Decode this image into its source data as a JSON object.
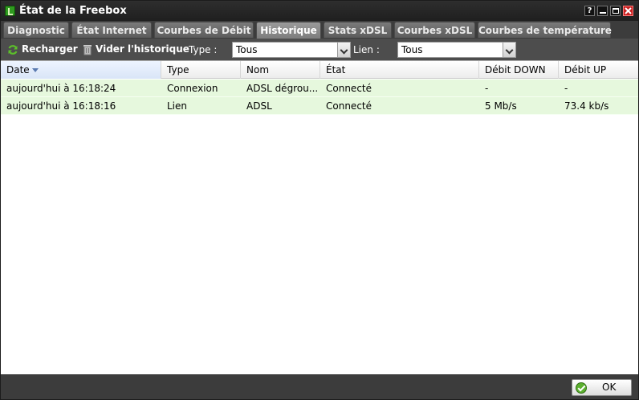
{
  "window": {
    "title": "État de la Freebox",
    "buttons": {
      "help": "?"
    }
  },
  "tabs": [
    {
      "label": "Diagnostic",
      "active": false
    },
    {
      "label": "État Internet",
      "active": false
    },
    {
      "label": "Courbes de Débit",
      "active": false
    },
    {
      "label": "Historique",
      "active": true
    },
    {
      "label": "Stats xDSL",
      "active": false
    },
    {
      "label": "Courbes xDSL",
      "active": false
    },
    {
      "label": "Courbes de température",
      "active": false
    }
  ],
  "toolbar": {
    "reload_label": "Recharger",
    "clear_label": "Vider l'historique",
    "type_label": "Type :",
    "type_value": "Tous",
    "link_label": "Lien :",
    "link_value": "Tous"
  },
  "table": {
    "columns": [
      "Date",
      "Type",
      "Nom",
      "État",
      "Débit DOWN",
      "Débit UP"
    ],
    "sorted_column": "Date",
    "rows": [
      [
        "aujourd'hui à 16:18:24",
        "Connexion",
        "ADSL dégrou...",
        "Connecté",
        "-",
        "-"
      ],
      [
        "aujourd'hui à 16:18:16",
        "Lien",
        "ADSL",
        "Connecté",
        "5 Mb/s",
        "73.4 kb/s"
      ]
    ]
  },
  "footer": {
    "ok_label": "OK"
  },
  "colors": {
    "titlebar": "#1f1f1f",
    "row_background": "#e6f8dd",
    "accent_green": "#5cb02f",
    "close_red": "#c82020"
  },
  "icons": {
    "reload": "refresh-icon",
    "clear": "trash-icon",
    "ok": "check-icon",
    "app": "freebox-icon"
  }
}
